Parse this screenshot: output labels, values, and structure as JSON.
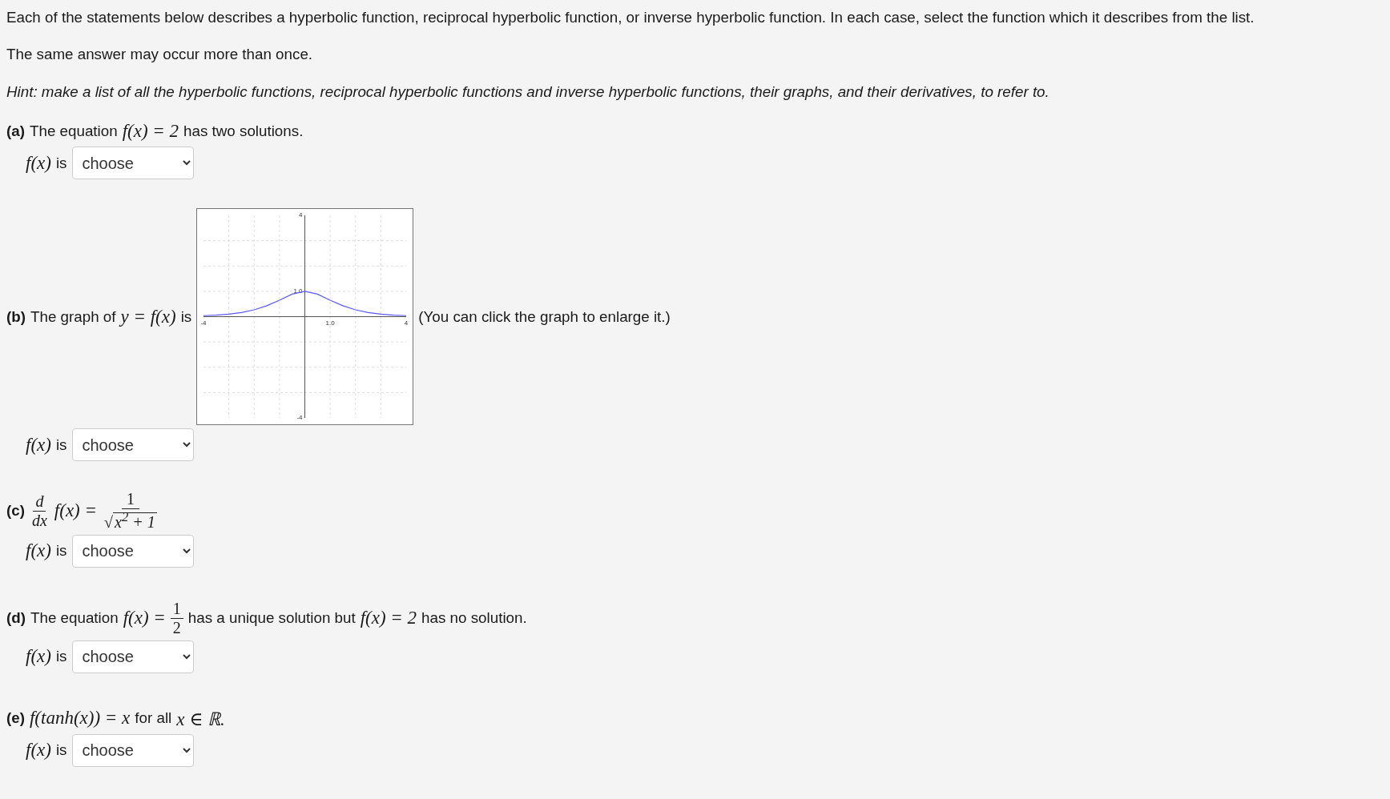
{
  "intro": [
    "Each of the statements below describes a hyperbolic function, reciprocal hyperbolic function, or inverse hyperbolic function. In each case, select the function which it describes from the list.",
    "The same answer may occur more than once."
  ],
  "hint": "Hint: make a list of all the hyperbolic functions, reciprocal hyperbolic functions and inverse hyperbolic functions, their graphs, and their derivatives, to refer to.",
  "questions": [
    {
      "label": "(a)",
      "parts": [
        {
          "kind": "text",
          "text": "The equation"
        },
        {
          "kind": "math",
          "text": "f(x) = 2"
        },
        {
          "kind": "text",
          "text": "has two solutions."
        }
      ],
      "answer": {
        "math": "f(x)",
        "text": "is",
        "select": "choose"
      }
    },
    {
      "label": "(b)",
      "parts": [
        {
          "kind": "text",
          "text": "The graph of"
        },
        {
          "kind": "math",
          "text": "y = f(x)"
        },
        {
          "kind": "text",
          "text": "is"
        },
        {
          "kind": "graph",
          "chart_data": {
            "type": "line",
            "xlim": [
              -4,
              4
            ],
            "ylim": [
              -4,
              4
            ],
            "xticks": [
              {
                "value": -4,
                "label": "-4"
              },
              {
                "value": 1,
                "label": "1.0"
              },
              {
                "value": 4,
                "label": "4"
              }
            ],
            "yticks": [
              {
                "value": -4,
                "label": "-4"
              },
              {
                "value": 1,
                "label": "1.0"
              },
              {
                "value": 4,
                "label": "4"
              }
            ],
            "x": [
              -4,
              -3.5,
              -3,
              -2.5,
              -2,
              -1.5,
              -1,
              -0.5,
              0,
              0.5,
              1,
              1.5,
              2,
              2.5,
              3,
              3.5,
              4
            ],
            "series": [
              {
                "color": "#5a5af0",
                "values": [
                  0.04,
                  0.06,
                  0.1,
                  0.16,
                  0.27,
                  0.43,
                  0.65,
                  0.89,
                  1,
                  0.89,
                  0.65,
                  0.43,
                  0.27,
                  0.16,
                  0.1,
                  0.06,
                  0.04
                ]
              }
            ]
          }
        },
        {
          "kind": "text",
          "text": "(You can click the graph to enlarge it.)"
        }
      ],
      "answer": {
        "math": "f(x)",
        "text": "is",
        "select": "choose"
      }
    },
    {
      "label": "(c)",
      "parts": [
        {
          "kind": "frac",
          "num": "d",
          "den": "dx"
        },
        {
          "kind": "math",
          "text": "f(x) ="
        },
        {
          "kind": "sqrtfrac",
          "num": "1",
          "root": "√",
          "radicand": "x$^{2}$ + 1"
        }
      ],
      "answer": {
        "math": "f(x)",
        "text": "is",
        "select": "choose"
      }
    },
    {
      "label": "(d)",
      "parts": [
        {
          "kind": "text",
          "text": "The equation"
        },
        {
          "kind": "math",
          "text": "f(x) ="
        },
        {
          "kind": "frac",
          "num": "1",
          "den": "2"
        },
        {
          "kind": "text",
          "text": "has a unique solution but"
        },
        {
          "kind": "math",
          "text": "f(x) = 2"
        },
        {
          "kind": "text",
          "text": "has no solution."
        }
      ],
      "answer": {
        "math": "f(x)",
        "text": "is",
        "select": "choose"
      }
    },
    {
      "label": "(e)",
      "parts": [
        {
          "kind": "math",
          "text": "f(tanh(x)) = x"
        },
        {
          "kind": "text",
          "text": "for all"
        },
        {
          "kind": "math",
          "text": "x ∈ ℝ."
        }
      ],
      "answer": {
        "math": "f(x)",
        "text": "is",
        "select": "choose"
      }
    }
  ]
}
